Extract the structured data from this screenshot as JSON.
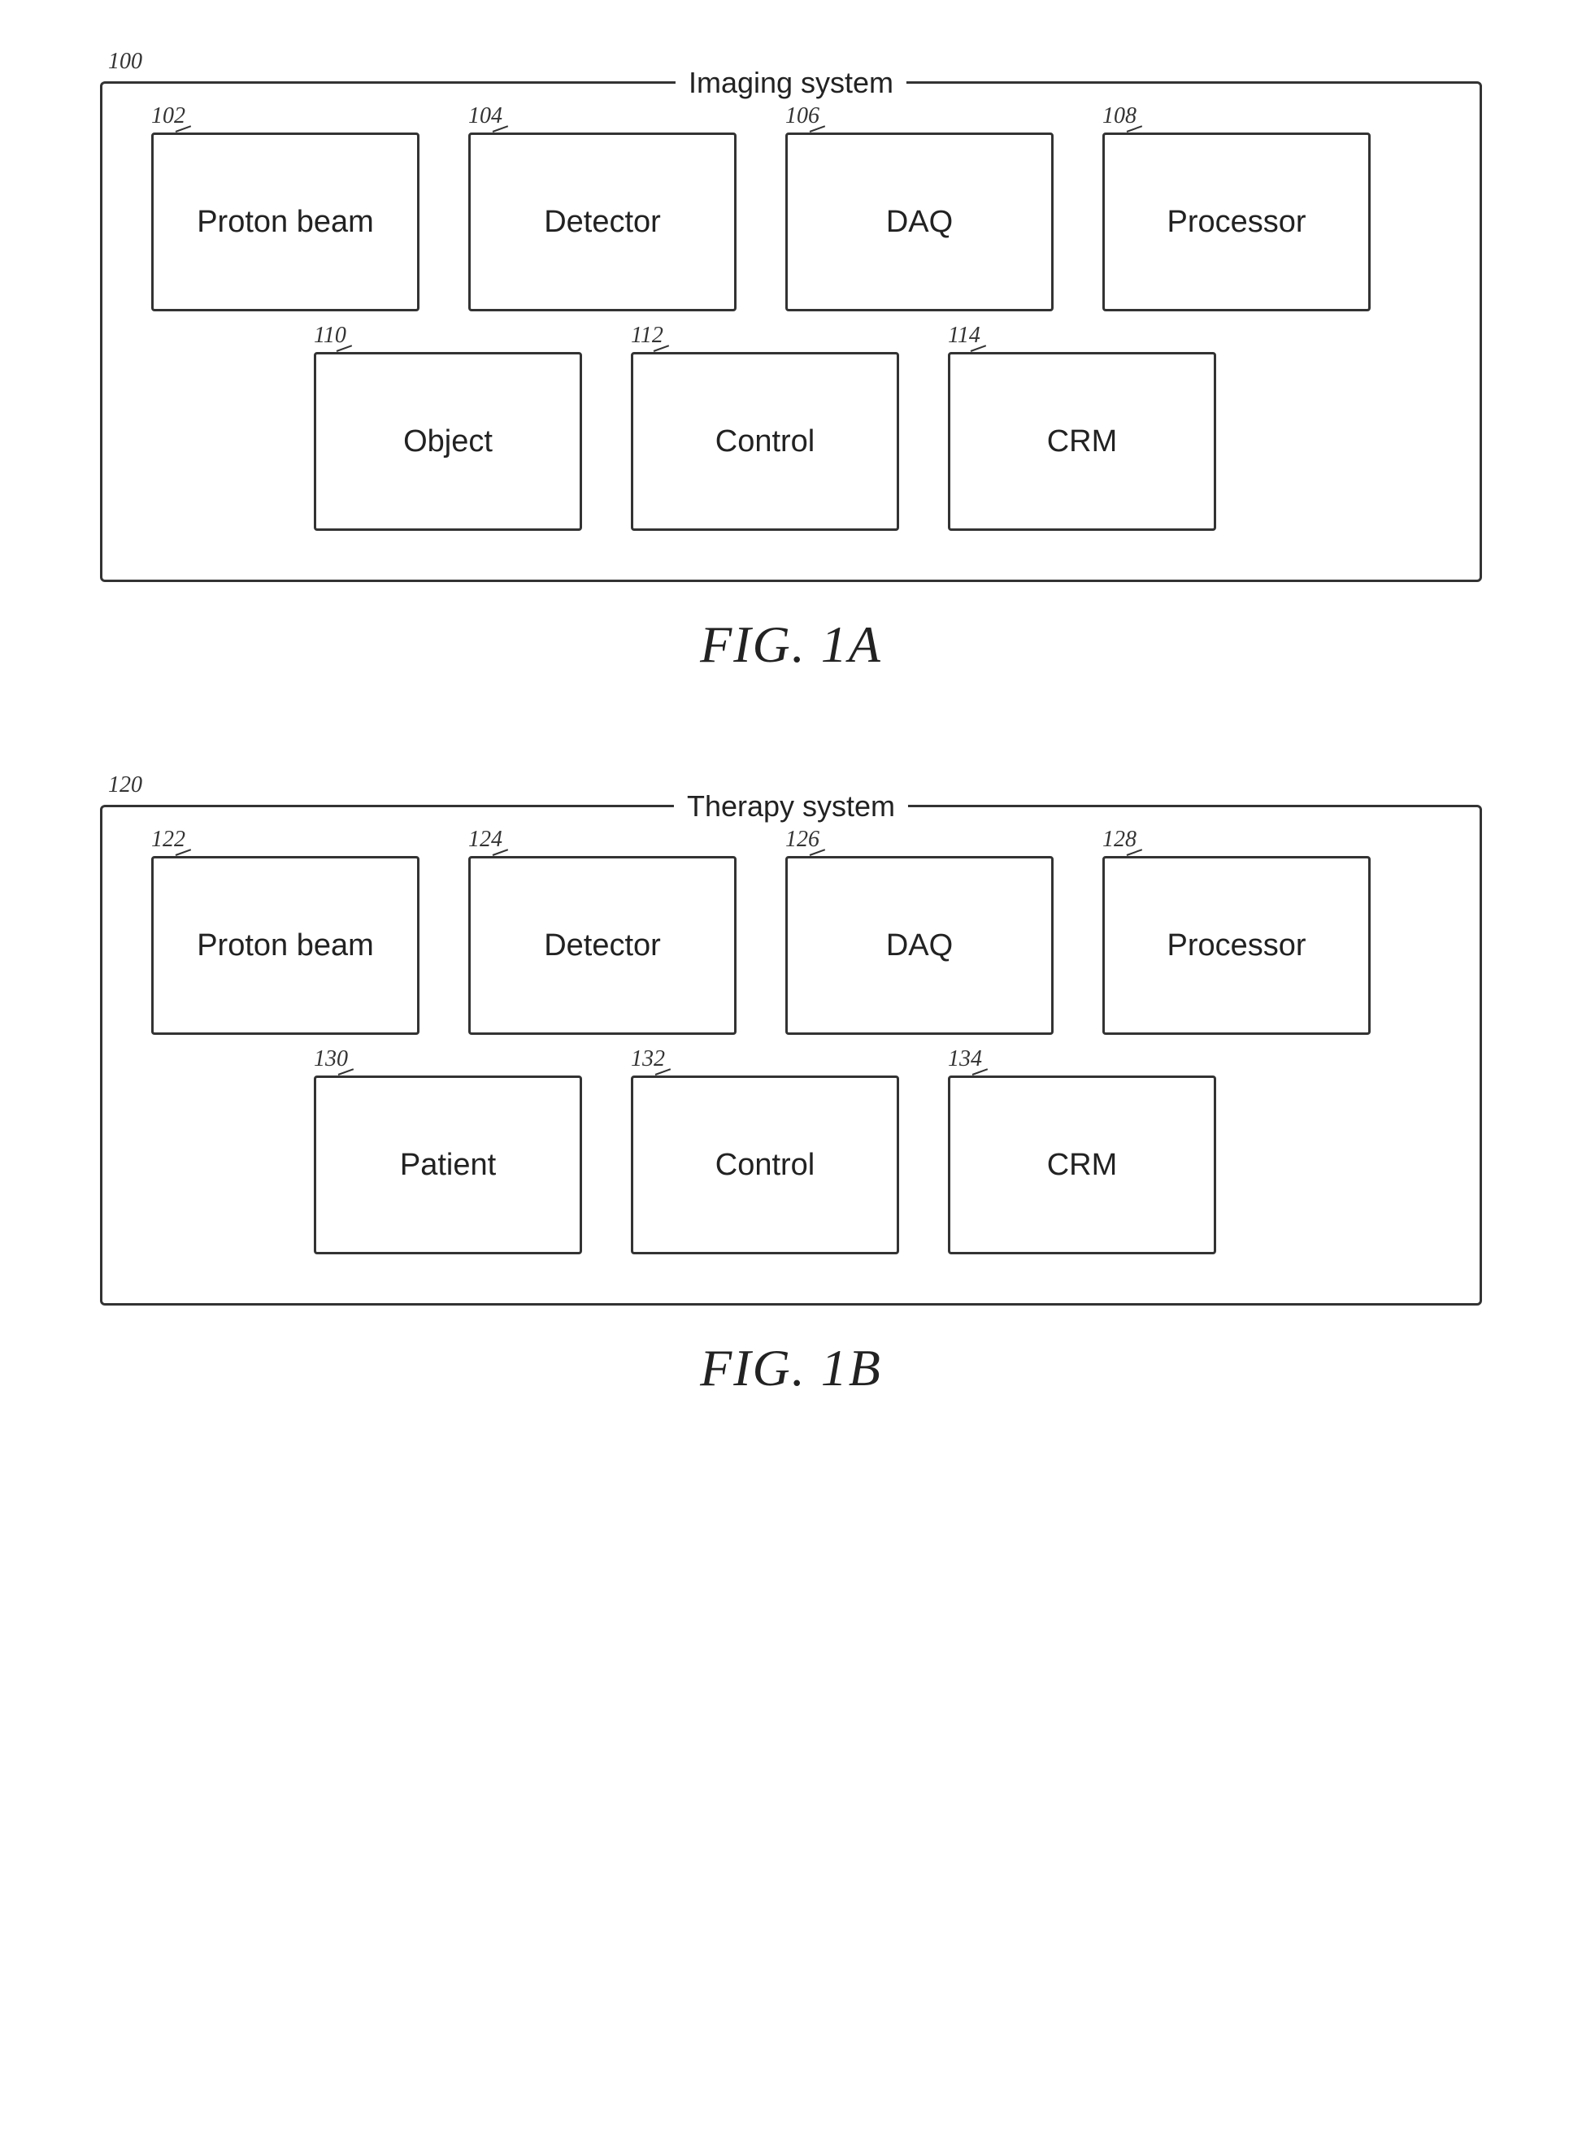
{
  "fig1a": {
    "outer_ref": "100",
    "system_title": "Imaging system",
    "fig_caption": "FIG. 1A",
    "top_row": [
      {
        "ref": "102",
        "label": "Proton beam"
      },
      {
        "ref": "104",
        "label": "Detector"
      },
      {
        "ref": "106",
        "label": "DAQ"
      },
      {
        "ref": "108",
        "label": "Processor"
      }
    ],
    "bottom_row": [
      {
        "ref": "110",
        "label": "Object"
      },
      {
        "ref": "112",
        "label": "Control"
      },
      {
        "ref": "114",
        "label": "CRM"
      }
    ]
  },
  "fig1b": {
    "outer_ref": "120",
    "system_title": "Therapy system",
    "fig_caption": "FIG. 1B",
    "top_row": [
      {
        "ref": "122",
        "label": "Proton beam"
      },
      {
        "ref": "124",
        "label": "Detector"
      },
      {
        "ref": "126",
        "label": "DAQ"
      },
      {
        "ref": "128",
        "label": "Processor"
      }
    ],
    "bottom_row": [
      {
        "ref": "130",
        "label": "Patient"
      },
      {
        "ref": "132",
        "label": "Control"
      },
      {
        "ref": "134",
        "label": "CRM"
      }
    ]
  }
}
